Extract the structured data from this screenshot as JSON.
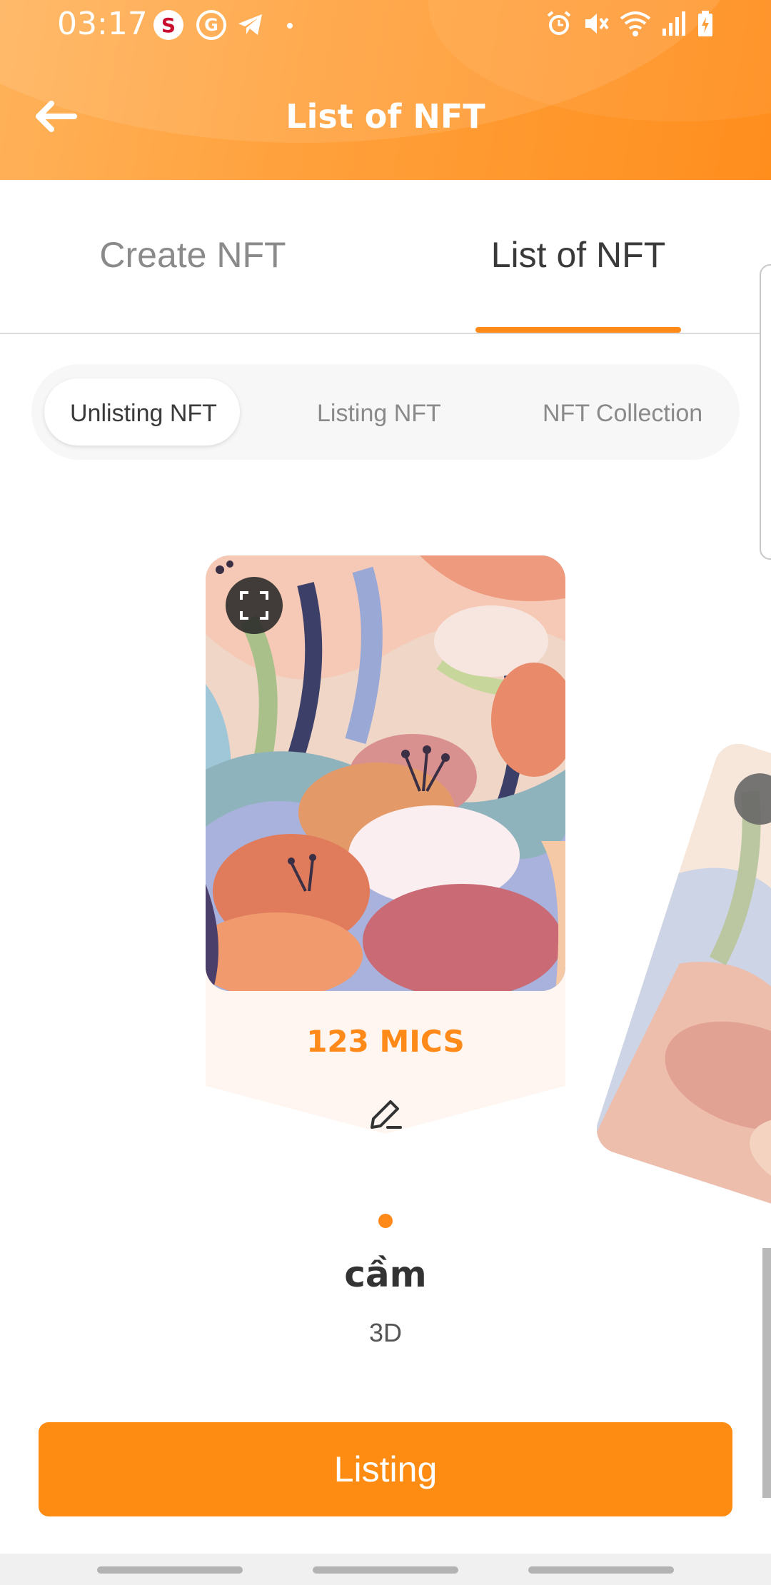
{
  "status_bar": {
    "time": "03:17",
    "app_icons": [
      "s-app-icon",
      "g-app-icon",
      "telegram-icon"
    ],
    "right_icons": [
      "alarm-icon",
      "mute-icon",
      "wifi-icon",
      "signal-icon",
      "battery-charging-icon"
    ]
  },
  "header": {
    "title": "List of NFT",
    "back_icon": "arrow-left-icon"
  },
  "tabs": [
    {
      "label": "Create NFT",
      "active": false
    },
    {
      "label": "List of NFT",
      "active": true
    }
  ],
  "segments": [
    {
      "label": "Unlisting NFT",
      "active": true
    },
    {
      "label": "Listing NFT",
      "active": false
    },
    {
      "label": "NFT Collection",
      "active": false
    }
  ],
  "nft": {
    "price": "123 MICS",
    "name": "cầm",
    "type": "3D",
    "expand_icon": "fullscreen-icon",
    "edit_icon": "pencil-icon"
  },
  "carousel": {
    "current_page": 1,
    "total_pages": 1
  },
  "actions": {
    "listing_label": "Listing"
  },
  "colors": {
    "accent": "#ff8a1a",
    "header_gradient_start": "#ffb25a",
    "header_gradient_end": "#ff8e1d",
    "card_bottom": "#fff6f1"
  }
}
